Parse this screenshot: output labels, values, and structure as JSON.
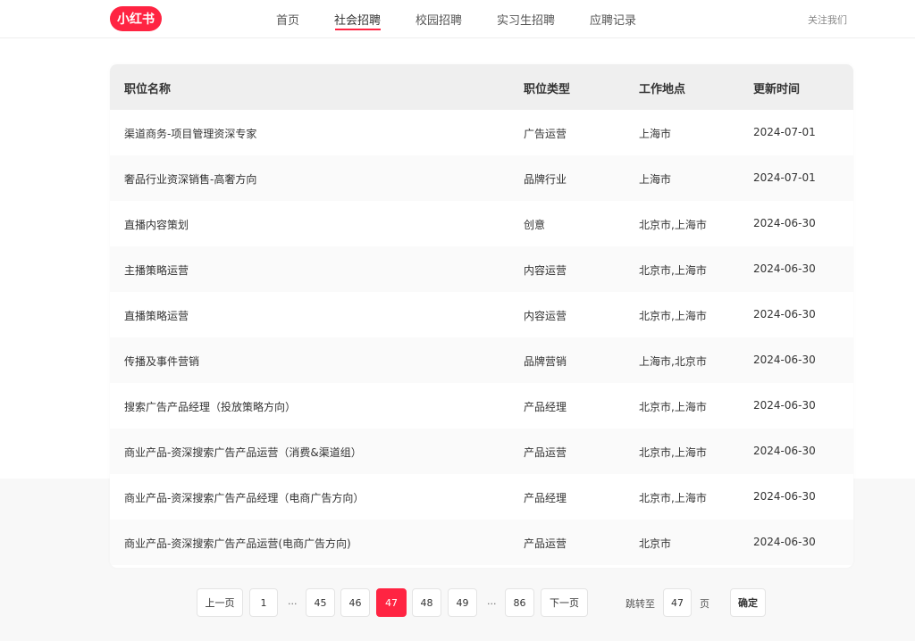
{
  "header": {
    "logo_text": "小红书",
    "nav": [
      {
        "label": "首页",
        "active": false
      },
      {
        "label": "社会招聘",
        "active": true
      },
      {
        "label": "校园招聘",
        "active": false
      },
      {
        "label": "实习生招聘",
        "active": false
      },
      {
        "label": "应聘记录",
        "active": false
      }
    ],
    "follow_label": "关注我们",
    "accent_color": "#ff2442"
  },
  "table": {
    "columns": [
      "职位名称",
      "职位类型",
      "工作地点",
      "更新时间"
    ],
    "rows": [
      {
        "title": "渠道商务-项目管理资深专家",
        "type": "广告运营",
        "location": "上海市",
        "updated": "2024-07-01"
      },
      {
        "title": "奢品行业资深销售-高奢方向",
        "type": "品牌行业",
        "location": "上海市",
        "updated": "2024-07-01"
      },
      {
        "title": "直播内容策划",
        "type": "创意",
        "location": "北京市,上海市",
        "updated": "2024-06-30"
      },
      {
        "title": "主播策略运营",
        "type": "内容运营",
        "location": "北京市,上海市",
        "updated": "2024-06-30"
      },
      {
        "title": "直播策略运营",
        "type": "内容运营",
        "location": "北京市,上海市",
        "updated": "2024-06-30"
      },
      {
        "title": "传播及事件营销",
        "type": "品牌营销",
        "location": "上海市,北京市",
        "updated": "2024-06-30"
      },
      {
        "title": "搜索广告产品经理（投放策略方向）",
        "type": "产品经理",
        "location": "北京市,上海市",
        "updated": "2024-06-30"
      },
      {
        "title": "商业产品-资深搜索广告产品运营（消费&渠道组）",
        "type": "产品运营",
        "location": "北京市,上海市",
        "updated": "2024-06-30"
      },
      {
        "title": "商业产品-资深搜索广告产品经理（电商广告方向）",
        "type": "产品经理",
        "location": "北京市,上海市",
        "updated": "2024-06-30"
      },
      {
        "title": "商业产品-资深搜索广告产品运营(电商广告方向)",
        "type": "产品运营",
        "location": "北京市",
        "updated": "2024-06-30"
      }
    ]
  },
  "pagination": {
    "prev_label": "上一页",
    "next_label": "下一页",
    "pages": [
      "1",
      "...",
      "45",
      "46",
      "47",
      "48",
      "49",
      "...",
      "86"
    ],
    "current": "47",
    "jump_prefix": "跳转至",
    "jump_value": "47",
    "jump_suffix": "页",
    "confirm_label": "确定"
  }
}
